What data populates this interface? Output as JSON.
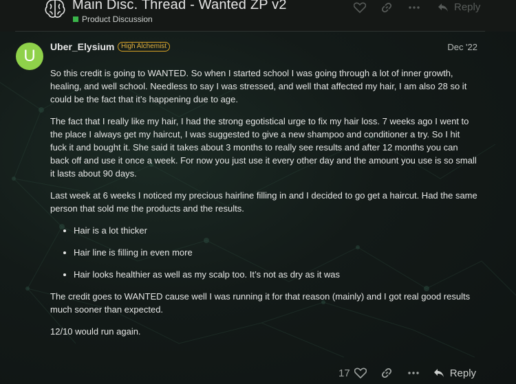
{
  "topic": {
    "title": "Main Disc. Thread - Wanted ZP v2",
    "category": "Product Discussion",
    "category_color": "#3ab54a"
  },
  "header_actions": {
    "reply_label": "Reply"
  },
  "post": {
    "avatar_letter": "U",
    "avatar_color": "#8fd14a",
    "username": "Uber_Elysium",
    "flair": "High Alchemist",
    "flair_color": "#d8a326",
    "date": "Dec '22",
    "paragraphs": [
      "So this credit is going to WANTED. So when I started school I was going through a lot of inner growth, healing, and well school. Needless to say I was stressed, and well that affected my hair, I am also 28 so it could be the fact that it’s happening due to age.",
      "The fact that I really like my hair, I had the strong egotistical urge to fix my hair loss. 7 weeks ago I went to the place I always get my haircut, I was suggested to give a new shampoo and conditioner a try. So I hit fuck it and bought it. She said it takes about 3 months to really see results and after 12 months you can back off and use it once a week. For now you just use it every other day and the amount you use is so small it lasts about 90 days.",
      "Last week at 6 weeks I noticed my precious hairline filling in and I decided to go get a haircut. Had the same person that sold me the products and the results."
    ],
    "bullets": [
      "Hair is a lot thicker",
      "Hair line is filling in even more",
      "Hair looks healthier as well as my scalp too. It’s not as dry as it was"
    ],
    "closing": [
      "The credit goes to WANTED cause well I was running it for that reason (mainly) and I got real good results much sooner than expected.",
      "12/10 would run again."
    ]
  },
  "actions": {
    "like_count": "17",
    "reply_label": "Reply",
    "icons": [
      "heart-icon",
      "link-icon",
      "ellipsis-icon",
      "reply-arrow-icon"
    ]
  }
}
